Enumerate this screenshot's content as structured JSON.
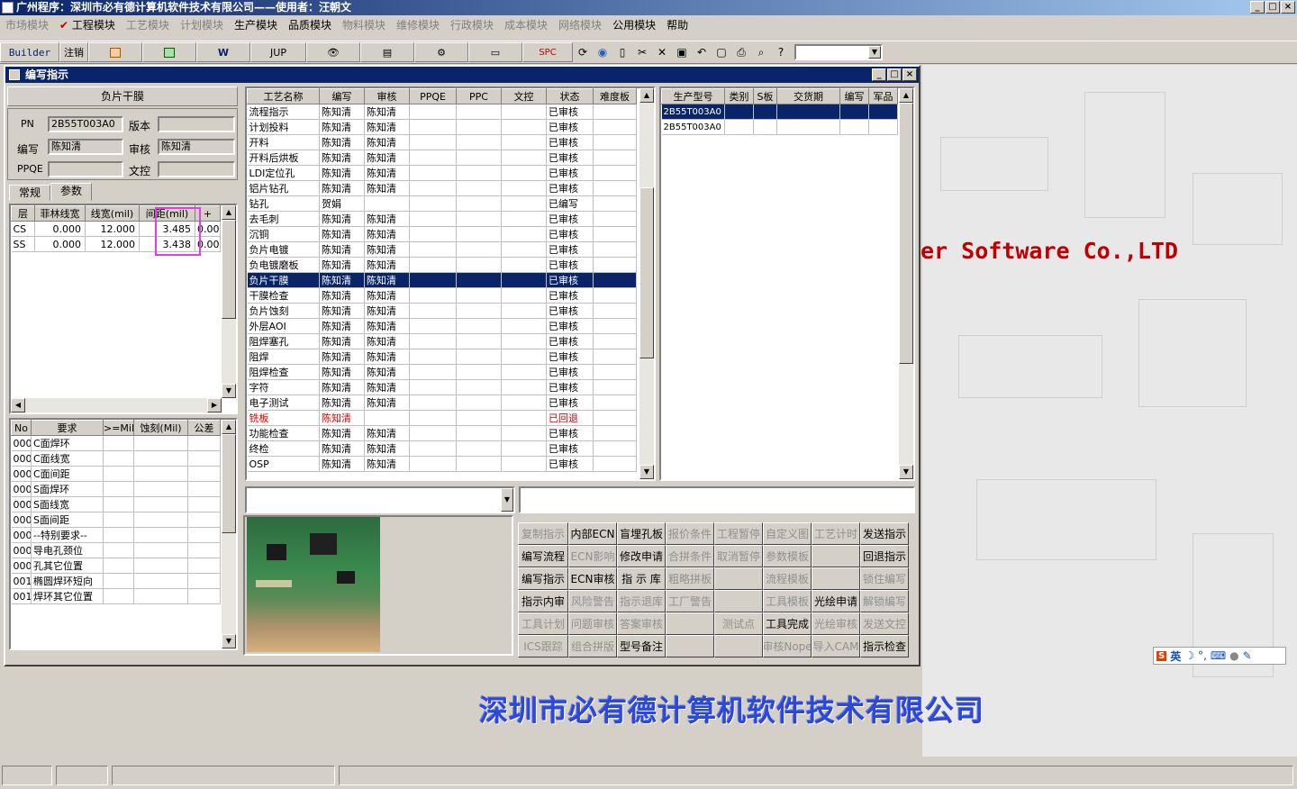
{
  "app": {
    "title": "广州程序：深圳市必有德计算机软件技术有限公司——使用者：汪朝文"
  },
  "window_controls": [
    "_",
    "□",
    "×"
  ],
  "menu": [
    {
      "label": "市场模块",
      "enabled": false
    },
    {
      "label": "工程模块",
      "enabled": true,
      "checked": true
    },
    {
      "label": "工艺模块",
      "enabled": false
    },
    {
      "label": "计划模块",
      "enabled": false
    },
    {
      "label": "生产模块",
      "enabled": true
    },
    {
      "label": "品质模块",
      "enabled": true
    },
    {
      "label": "物料模块",
      "enabled": false
    },
    {
      "label": "维修模块",
      "enabled": false
    },
    {
      "label": "行政模块",
      "enabled": false
    },
    {
      "label": "成本模块",
      "enabled": false
    },
    {
      "label": "网络模块",
      "enabled": false
    },
    {
      "label": "公用模块",
      "enabled": true
    },
    {
      "label": "帮助",
      "enabled": true
    }
  ],
  "toolbar": {
    "builder": "Builder",
    "logout": "注销",
    "jup": "JUP",
    "spc": "SPC",
    "word_icon": "W"
  },
  "brand_text": "er Software Co.,LTD",
  "company_text": "深圳市必有德计算机软件技术有限公司",
  "child": {
    "title": "编写指示",
    "section_title": "负片干膜",
    "form": {
      "pn_label": "PN",
      "pn_value": "2B55T003A0",
      "version_label": "版本",
      "version_value": "",
      "writer_label": "编写",
      "writer_value": "陈知清",
      "review_label": "审核",
      "review_value": "陈知清",
      "ppqe_label": "PPQE",
      "ppqe_value": "",
      "doc_label": "文控",
      "doc_value": ""
    },
    "tabs": [
      "常规",
      "参数"
    ],
    "param_grid": {
      "headers": [
        "层",
        "菲林线宽",
        "线宽(mil)",
        "间距(mil)",
        "+"
      ],
      "rows": [
        [
          "CS",
          "0.000",
          "12.000",
          "3.485",
          "0.00"
        ],
        [
          "SS",
          "0.000",
          "12.000",
          "3.438",
          "0.00"
        ]
      ]
    },
    "req_grid": {
      "headers": [
        "No",
        "要求",
        ">=Mil",
        "蚀刻(Mil)",
        "公差"
      ],
      "rows": [
        [
          "000",
          "C面焊环"
        ],
        [
          "000",
          "C面线宽"
        ],
        [
          "000",
          "C面间距"
        ],
        [
          "000",
          "S面焊环"
        ],
        [
          "000",
          "S面线宽"
        ],
        [
          "000",
          "S面间距"
        ],
        [
          "000",
          "--特别要求--"
        ],
        [
          "000",
          "导电孔颈位"
        ],
        [
          "000",
          "孔其它位置"
        ],
        [
          "001",
          "椭圆焊环短向"
        ],
        [
          "001",
          "焊环其它位置"
        ]
      ]
    },
    "process_grid": {
      "headers": [
        "工艺名称",
        "编写",
        "审核",
        "PPQE",
        "PPC",
        "文控",
        "状态",
        "难度板"
      ],
      "rows": [
        [
          "流程指示",
          "陈知清",
          "陈知清",
          "",
          "",
          "",
          "已审核"
        ],
        [
          "计划投料",
          "陈知清",
          "陈知清",
          "",
          "",
          "",
          "已审核"
        ],
        [
          "开料",
          "陈知清",
          "陈知清",
          "",
          "",
          "",
          "已审核"
        ],
        [
          "开料后烘板",
          "陈知清",
          "陈知清",
          "",
          "",
          "",
          "已审核"
        ],
        [
          "LDI定位孔",
          "陈知清",
          "陈知清",
          "",
          "",
          "",
          "已审核"
        ],
        [
          "铝片钻孔",
          "陈知清",
          "陈知清",
          "",
          "",
          "",
          "已审核"
        ],
        [
          "钻孔",
          "贺娟",
          "",
          "",
          "",
          "",
          "已编写"
        ],
        [
          "去毛刺",
          "陈知清",
          "陈知清",
          "",
          "",
          "",
          "已审核"
        ],
        [
          "沉铜",
          "陈知清",
          "陈知清",
          "",
          "",
          "",
          "已审核"
        ],
        [
          "负片电镀",
          "陈知清",
          "陈知清",
          "",
          "",
          "",
          "已审核"
        ],
        [
          "负电镀磨板",
          "陈知清",
          "陈知清",
          "",
          "",
          "",
          "已审核"
        ],
        [
          "负片干膜",
          "陈知清",
          "陈知清",
          "",
          "",
          "",
          "已审核"
        ],
        [
          "干膜检查",
          "陈知清",
          "陈知清",
          "",
          "",
          "",
          "已审核"
        ],
        [
          "负片蚀刻",
          "陈知清",
          "陈知清",
          "",
          "",
          "",
          "已审核"
        ],
        [
          "外层AOI",
          "陈知清",
          "陈知清",
          "",
          "",
          "",
          "已审核"
        ],
        [
          "阻焊塞孔",
          "陈知清",
          "陈知清",
          "",
          "",
          "",
          "已审核"
        ],
        [
          "阻焊",
          "陈知清",
          "陈知清",
          "",
          "",
          "",
          "已审核"
        ],
        [
          "阻焊检查",
          "陈知清",
          "陈知清",
          "",
          "",
          "",
          "已审核"
        ],
        [
          "字符",
          "陈知清",
          "陈知清",
          "",
          "",
          "",
          "已审核"
        ],
        [
          "电子测试",
          "陈知清",
          "陈知清",
          "",
          "",
          "",
          "已审核"
        ],
        [
          "铣板",
          "陈知清",
          "",
          "",
          "",
          "",
          "已回退"
        ],
        [
          "功能检查",
          "陈知清",
          "陈知清",
          "",
          "",
          "",
          "已审核"
        ],
        [
          "终检",
          "陈知清",
          "陈知清",
          "",
          "",
          "",
          "已审核"
        ],
        [
          "OSP",
          "陈知清",
          "陈知清",
          "",
          "",
          "",
          "已审核"
        ]
      ],
      "selected_row": 11,
      "rejected_row": 20
    },
    "model_grid": {
      "headers": [
        "生产型号",
        "类别",
        "S板",
        "交货期",
        "编写",
        "军品"
      ],
      "rows": [
        [
          "2B55T003A0"
        ],
        [
          "2B55T003A0"
        ]
      ]
    },
    "buttons": [
      [
        {
          "l": "复制指示",
          "e": false
        },
        {
          "l": "内部ECN",
          "e": true
        },
        {
          "l": "盲埋孔板",
          "e": true
        },
        {
          "l": "报价条件",
          "e": false
        },
        {
          "l": "工程暂停",
          "e": false
        },
        {
          "l": "自定义图",
          "e": false
        },
        {
          "l": "工艺计时",
          "e": false
        },
        {
          "l": "发送指示",
          "e": true
        }
      ],
      [
        {
          "l": "编写流程",
          "e": true
        },
        {
          "l": "ECN影响",
          "e": false
        },
        {
          "l": "修改申请",
          "e": true
        },
        {
          "l": "合拼条件",
          "e": false
        },
        {
          "l": "取消暂停",
          "e": false
        },
        {
          "l": "参数模板",
          "e": false
        },
        {
          "l": "",
          "e": false
        },
        {
          "l": "回退指示",
          "e": true
        }
      ],
      [
        {
          "l": "编写指示",
          "e": true
        },
        {
          "l": "ECN审核",
          "e": true
        },
        {
          "l": "指 示 库",
          "e": true
        },
        {
          "l": "粗略拼板",
          "e": false
        },
        {
          "l": "",
          "e": false
        },
        {
          "l": "流程模板",
          "e": false
        },
        {
          "l": "",
          "e": false
        },
        {
          "l": "锁住编写",
          "e": false
        }
      ],
      [
        {
          "l": "指示内审",
          "e": true
        },
        {
          "l": "风险警告",
          "e": false
        },
        {
          "l": "指示退库",
          "e": false
        },
        {
          "l": "工厂警告",
          "e": false
        },
        {
          "l": "",
          "e": false
        },
        {
          "l": "工具模板",
          "e": false
        },
        {
          "l": "光绘申请",
          "e": true
        },
        {
          "l": "解锁编写",
          "e": false
        }
      ],
      [
        {
          "l": "工具计划",
          "e": false
        },
        {
          "l": "问题审核",
          "e": false
        },
        {
          "l": "答案审核",
          "e": false
        },
        {
          "l": "",
          "e": false
        },
        {
          "l": "测试点",
          "e": false
        },
        {
          "l": "工具完成",
          "e": true
        },
        {
          "l": "光绘审核",
          "e": false
        },
        {
          "l": "发送文控",
          "e": false
        }
      ],
      [
        {
          "l": "ICS跟踪",
          "e": false
        },
        {
          "l": "组合拼版",
          "e": false
        },
        {
          "l": "型号备注",
          "e": true
        },
        {
          "l": "",
          "e": false
        },
        {
          "l": "",
          "e": false
        },
        {
          "l": "审核Nope",
          "e": false
        },
        {
          "l": "导入CAM",
          "e": false
        },
        {
          "l": "指示检查",
          "e": true
        }
      ]
    ]
  },
  "ime": {
    "lang": "英"
  },
  "colors": {
    "title_bg": "#0a246a",
    "selection": "#0a246a",
    "highlight_box": "#e040e0",
    "rejected_text": "#e00000",
    "brand_red": "#c00000",
    "company_blue": "#2c48d8"
  }
}
